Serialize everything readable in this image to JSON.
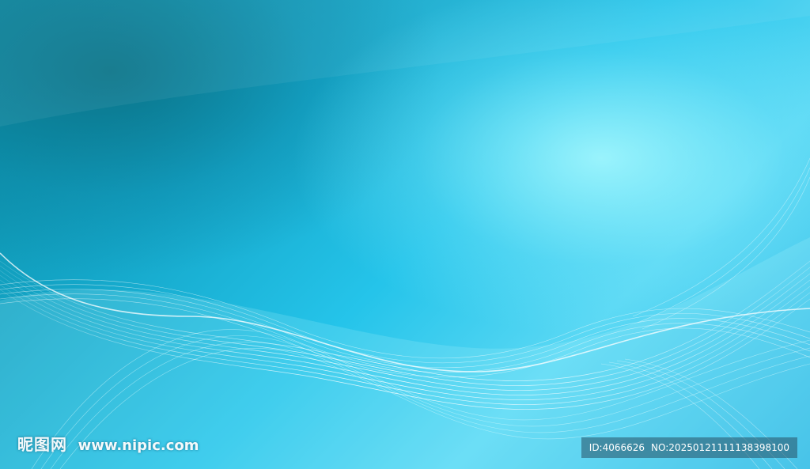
{
  "background": {
    "description_colors": [
      "#0a8aa0",
      "#25c4ea",
      "#aaf8ff"
    ]
  },
  "watermark": {
    "logo": "昵图网",
    "url": "www.nipic.com",
    "id": "ID:4066626",
    "no": "NO:20250121111138398100"
  }
}
